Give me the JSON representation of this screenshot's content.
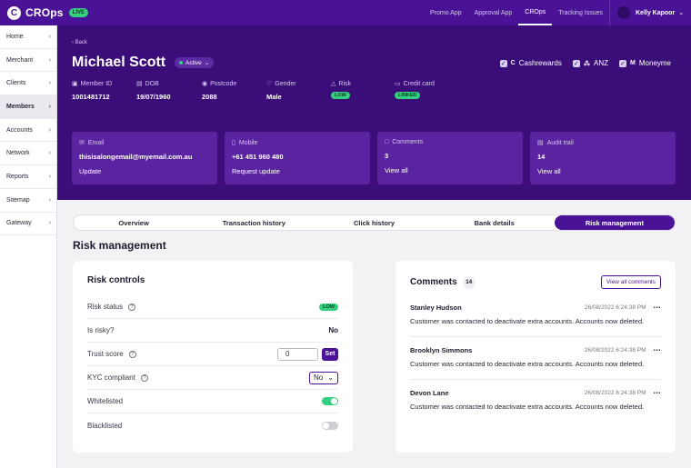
{
  "app": {
    "logo_mark": "C",
    "name": "CROps",
    "env_badge": "LIVE"
  },
  "topnav": [
    {
      "label": "Promo App",
      "active": false
    },
    {
      "label": "Approval App",
      "active": false
    },
    {
      "label": "CROps",
      "active": true
    },
    {
      "label": "Tracking Issues",
      "active": false
    }
  ],
  "user": {
    "name": "Kelly Kapoor"
  },
  "sidebar": {
    "items": [
      {
        "label": "Home",
        "active": false
      },
      {
        "label": "Merchant",
        "active": false
      },
      {
        "label": "Clients",
        "active": false
      },
      {
        "label": "Members",
        "active": true
      },
      {
        "label": "Accounts",
        "active": false
      },
      {
        "label": "Network",
        "active": false
      },
      {
        "label": "Reports",
        "active": false
      },
      {
        "label": "Sitemap",
        "active": false
      },
      {
        "label": "Gateway",
        "active": false
      }
    ]
  },
  "header": {
    "back_label": "Back",
    "member_name": "Michael Scott",
    "status": "Active",
    "brands": [
      {
        "label": "Cashrewards",
        "icon": "C",
        "checked": true
      },
      {
        "label": "ANZ",
        "icon": "⁂",
        "checked": true
      },
      {
        "label": "Moneyme",
        "icon": "M",
        "checked": true
      }
    ],
    "fields": {
      "member_id": {
        "label": "Member ID",
        "value": "1001481712"
      },
      "dob": {
        "label": "DOB",
        "value": "19/07/1960"
      },
      "postcode": {
        "label": "Postcode",
        "value": "2088"
      },
      "gender": {
        "label": "Gender",
        "value": "Male"
      },
      "risk": {
        "label": "Risk",
        "value": "LOW"
      },
      "credit_card": {
        "label": "Credit card",
        "value": "LINKED"
      }
    },
    "cards": {
      "email": {
        "label": "Email",
        "value": "thisisalongemail@myemail.com.au",
        "action": "Update"
      },
      "mobile": {
        "label": "Mobile",
        "value": "+61 451 960 480",
        "action": "Request update"
      },
      "comments": {
        "label": "Comments",
        "value": "3",
        "action": "View all"
      },
      "audit": {
        "label": "Audit trail",
        "value": "14",
        "action": "View all"
      }
    }
  },
  "tabs": [
    {
      "label": "Overview",
      "active": false
    },
    {
      "label": "Transaction history",
      "active": false
    },
    {
      "label": "Click history",
      "active": false
    },
    {
      "label": "Bank details",
      "active": false
    },
    {
      "label": "Risk management",
      "active": true
    }
  ],
  "section_title": "Risk management",
  "risk_controls": {
    "title": "Risk controls",
    "risk_status": {
      "label": "Risk status",
      "value": "LOW"
    },
    "is_risky": {
      "label": "Is risky?",
      "value": "No"
    },
    "trust_score": {
      "label": "Trust score",
      "value": "0",
      "button": "Set"
    },
    "kyc": {
      "label": "KYC compliant",
      "value": "No"
    },
    "whitelisted": {
      "label": "Whitelisted",
      "on": true
    },
    "blacklisted": {
      "label": "Blacklisted",
      "on": false
    }
  },
  "comments": {
    "title": "Comments",
    "count": "14",
    "view_all_label": "View all comments",
    "items": [
      {
        "author": "Stanley Hudson",
        "time": "26/08/2022 6:24:38 PM",
        "text": "Customer was contacted to deactivate extra accounts. Accounts now deleted."
      },
      {
        "author": "Brooklyn Simmons",
        "time": "26/08/2022 6:24:38 PM",
        "text": "Customer was contacted to deactivate extra accounts. Accounts now deleted."
      },
      {
        "author": "Devon Lane",
        "time": "26/08/2022 6:24:38 PM",
        "text": "Customer was contacted to deactivate extra accounts. Accounts now deleted."
      }
    ]
  }
}
